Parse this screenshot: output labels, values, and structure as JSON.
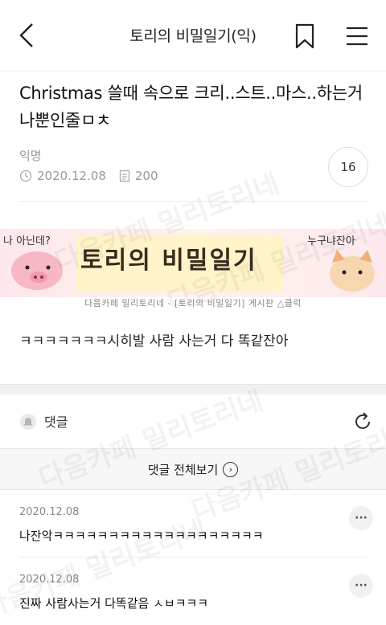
{
  "header": {
    "title": "토리의 비밀일기(익)",
    "icons": {
      "back": "back-chevron-icon",
      "bookmark": "bookmark-icon",
      "menu": "hamburger-menu-icon"
    }
  },
  "post": {
    "title": "Christmas 쓸때 속으로 크리..스트..마스..하는거 나뿐인줄ㅁㅊ",
    "author": "익명",
    "date": "2020.12.08",
    "views": "200",
    "comment_count": "16",
    "body": "ㅋㅋㅋㅋㅋㅋㅋ시히발 사람 사는거 다 똑같잔아"
  },
  "banner": {
    "title": "토리의 비밀일기",
    "left_text": "나 아닌데?",
    "right_text": "누구냐잔아",
    "caption": "다음카페 밀리토리네 - [토리의 비밀일기] 게시판 △클럭"
  },
  "comments": {
    "label": "댓글",
    "view_all": "댓글 전체보기",
    "items": [
      {
        "date": "2020.12.08",
        "text": "나잔악ㅋㅋㅋㅋㅋㅋㅋㅋㅋㅋㅋㅋㅋㅋㅋㅋㅋㅋㅋ"
      },
      {
        "date": "2020.12.08",
        "text": "진짜 사람사는거 다똑같음 ㅅㅂㅋㅋㅋ"
      }
    ]
  },
  "watermark": "다음카페 밀리토리네",
  "colors": {
    "accent_border": "#dcdcdc",
    "meta_gray": "#9a9a9a",
    "section_bg": "#f2f2f2"
  }
}
